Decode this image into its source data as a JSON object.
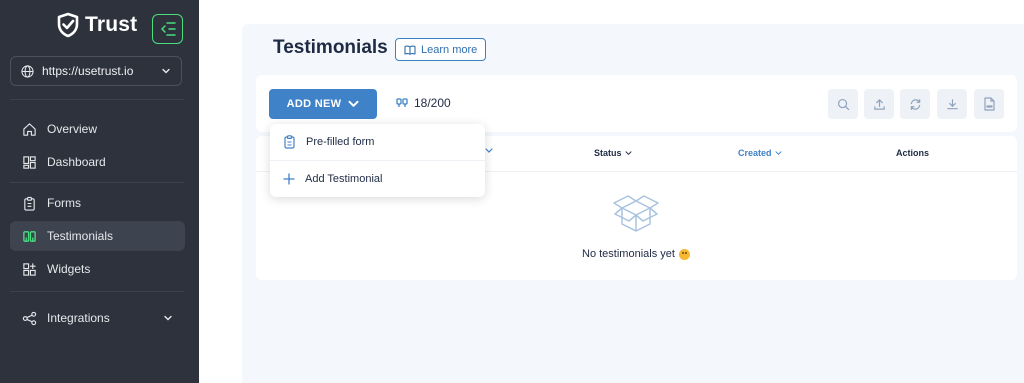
{
  "brand": {
    "name": "Trust",
    "accent": "#4ade80",
    "primary": "#3f82c8",
    "sidebar_bg": "#2d323c"
  },
  "sidebar": {
    "site_url": "https://usetrust.io",
    "items": [
      {
        "label": "Overview",
        "icon": "home-icon"
      },
      {
        "label": "Dashboard",
        "icon": "dashboard-icon"
      },
      {
        "label": "Forms",
        "icon": "clipboard-icon"
      },
      {
        "label": "Testimonials",
        "icon": "quote-icon",
        "active": true
      },
      {
        "label": "Widgets",
        "icon": "widgets-icon"
      },
      {
        "label": "Integrations",
        "icon": "share-icon",
        "expandable": true
      }
    ]
  },
  "page": {
    "title": "Testimonials",
    "learn_more": "Learn more"
  },
  "toolbar": {
    "add_new": "ADD NEW",
    "count": "18/200",
    "tools": [
      "search-icon",
      "upload-icon",
      "refresh-icon",
      "download-icon",
      "csv-export-icon"
    ]
  },
  "dropdown": {
    "items": [
      {
        "label": "Pre-filled form",
        "icon": "clipboard-icon"
      },
      {
        "label": "Add Testimonial",
        "icon": "plus-icon"
      }
    ]
  },
  "table": {
    "columns": [
      "Status",
      "Created",
      "Actions"
    ],
    "empty_text": "No testimonials yet"
  }
}
